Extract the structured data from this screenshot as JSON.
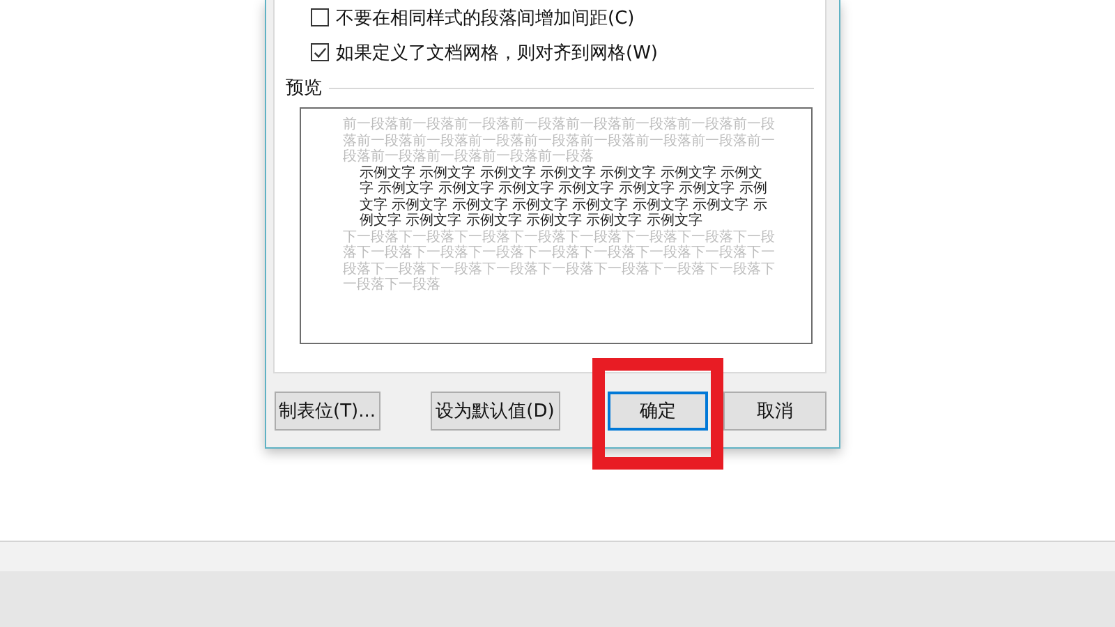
{
  "options": [
    {
      "label": "不要在相同样式的段落间增加间距(C)",
      "checked": false
    },
    {
      "label": "如果定义了文档网格，则对齐到网格(W)",
      "checked": true
    }
  ],
  "preview": {
    "title": "预览",
    "before": "前一段落前一段落前一段落前一段落前一段落前一段落前一段落前一段落前一段落前一段落前一段落前一段落前一段落前一段落前一段落前一段落前一段落前一段落前一段落前一段落",
    "sample": "示例文字 示例文字 示例文字 示例文字 示例文字 示例文字 示例文字 示例文字 示例文字 示例文字 示例文字 示例文字 示例文字 示例文字 示例文字 示例文字 示例文字 示例文字 示例文字 示例文字 示例文字 示例文字 示例文字 示例文字 示例文字 示例文字",
    "after": "下一段落下一段落下一段落下一段落下一段落下一段落下一段落下一段落下一段落下一段落下一段落下一段落下一段落下一段落下一段落下一段落下一段落下一段落下一段落下一段落下一段落下一段落下一段落下一段落下一段落"
  },
  "buttons": [
    {
      "label": "制表位(T)...",
      "default": false
    },
    {
      "label": "设为默认值(D)",
      "default": false
    },
    {
      "label": "确定",
      "default": true
    },
    {
      "label": "取消",
      "default": false
    }
  ]
}
